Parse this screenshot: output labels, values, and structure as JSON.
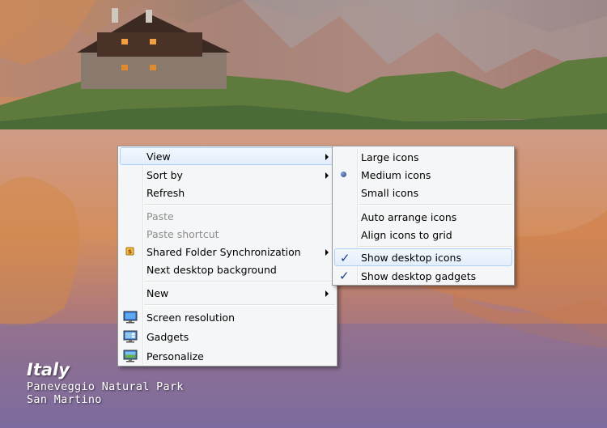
{
  "wallpaper": {
    "title": "Italy",
    "line1": "Paneveggio Natural Park",
    "line2": "San Martino"
  },
  "context_menu": {
    "items": [
      {
        "label": "View",
        "has_submenu": true,
        "highlighted": true
      },
      {
        "label": "Sort by",
        "has_submenu": true
      },
      {
        "label": "Refresh"
      },
      {
        "label": "Paste",
        "disabled": true
      },
      {
        "label": "Paste shortcut",
        "disabled": true
      },
      {
        "label": "Shared Folder Synchronization",
        "has_submenu": true,
        "icon": "sync-folder-icon"
      },
      {
        "label": "Next desktop background"
      },
      {
        "label": "New",
        "has_submenu": true
      },
      {
        "label": "Screen resolution",
        "icon": "monitor-icon"
      },
      {
        "label": "Gadgets",
        "icon": "gadgets-icon"
      },
      {
        "label": "Personalize",
        "icon": "personalize-icon"
      }
    ]
  },
  "view_submenu": {
    "items": [
      {
        "label": "Large icons"
      },
      {
        "label": "Medium icons",
        "selected": true
      },
      {
        "label": "Small icons"
      },
      {
        "label": "Auto arrange icons"
      },
      {
        "label": "Align icons to grid"
      },
      {
        "label": "Show desktop icons",
        "checked": true,
        "highlighted": true
      },
      {
        "label": "Show desktop gadgets",
        "checked": true
      }
    ]
  },
  "colors": {
    "menu_background": "#f5f6f7",
    "highlight_border": "#aecff7",
    "check_color": "#1a3c8a"
  }
}
